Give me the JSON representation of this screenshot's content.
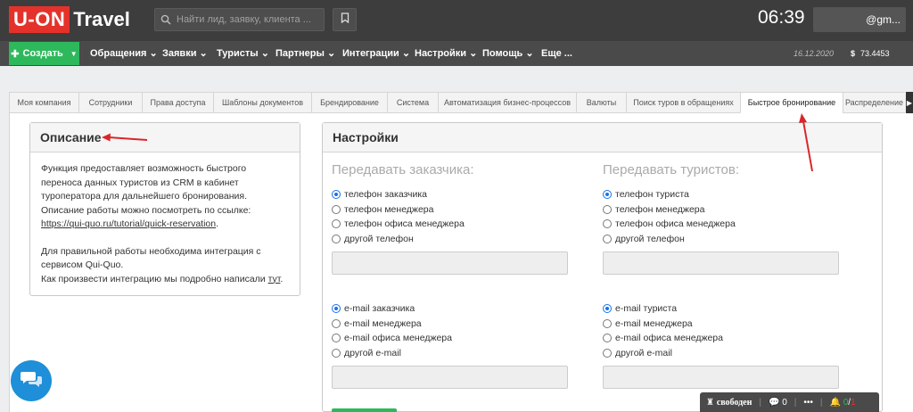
{
  "header": {
    "logo_box": "U-ON",
    "logo_text": "Travel",
    "search_placeholder": "Найти лид, заявку, клиента ...",
    "time": "06:39",
    "user_email": "@gm..."
  },
  "nav": {
    "create_label": "Создать",
    "items": [
      "Обращения",
      "Заявки",
      "Туристы",
      "Партнеры",
      "Интеграции",
      "Настройки",
      "Помощь",
      "Еще ..."
    ],
    "date": "16.12.2020",
    "balance_symbol": "$",
    "balance": "73.4453"
  },
  "tabs": [
    "Моя компания",
    "Сотрудники",
    "Права доступа",
    "Шаблоны документов",
    "Брендирование",
    "Система",
    "Автоматизация бизнес-процессов",
    "Валюты",
    "Поиск туров в обращениях",
    "Быстрое бронирование",
    "Распределение"
  ],
  "active_tab_index": 9,
  "description": {
    "title": "Описание",
    "p1_line1": "Функция предоставляет возможность быстрого",
    "p1_line2": "переноса данных туристов из CRM в кабинет",
    "p1_line3": "туроператора для дальнейшего бронирования.",
    "p1_line4": "Описание работы можно посмотреть по ссылке:",
    "link": "https://qui-quo.ru/tutorial/quick-reservation",
    "link_suffix": ".",
    "p2_line1": "Для правильной работы необходима интеграция с",
    "p2_line2": "сервисом Qui-Quo.",
    "p2_line3_prefix": "Как произвести интеграцию мы подробно написали ",
    "p2_link": "тут",
    "p2_suffix": "."
  },
  "settings": {
    "title": "Настройки",
    "customer": {
      "title": "Передавать заказчика:",
      "phone_options": [
        "телефон заказчика",
        "телефон менеджера",
        "телефон офиса менеджера",
        "другой телефон"
      ],
      "phone_selected": 0,
      "email_options": [
        "e-mail заказчика",
        "e-mail менеджера",
        "e-mail офиса менеджера",
        "другой e-mail"
      ],
      "email_selected": 0
    },
    "tourists": {
      "title": "Передавать туристов:",
      "phone_options": [
        "телефон туриста",
        "телефон менеджера",
        "телефон офиса менеджера",
        "другой телефон"
      ],
      "phone_selected": 0,
      "email_options": [
        "e-mail туриста",
        "e-mail менеджера",
        "e-mail офиса менеджера",
        "другой e-mail"
      ],
      "email_selected": 0
    }
  },
  "status_bar": {
    "status": "свободен",
    "messages": "0",
    "notif_a": "0",
    "notif_b": "1"
  },
  "colors": {
    "accent_green": "#2eb85c",
    "logo_red": "#e4322b",
    "radio_blue": "#1a73e8",
    "annotation_arrow": "#d9262b"
  }
}
